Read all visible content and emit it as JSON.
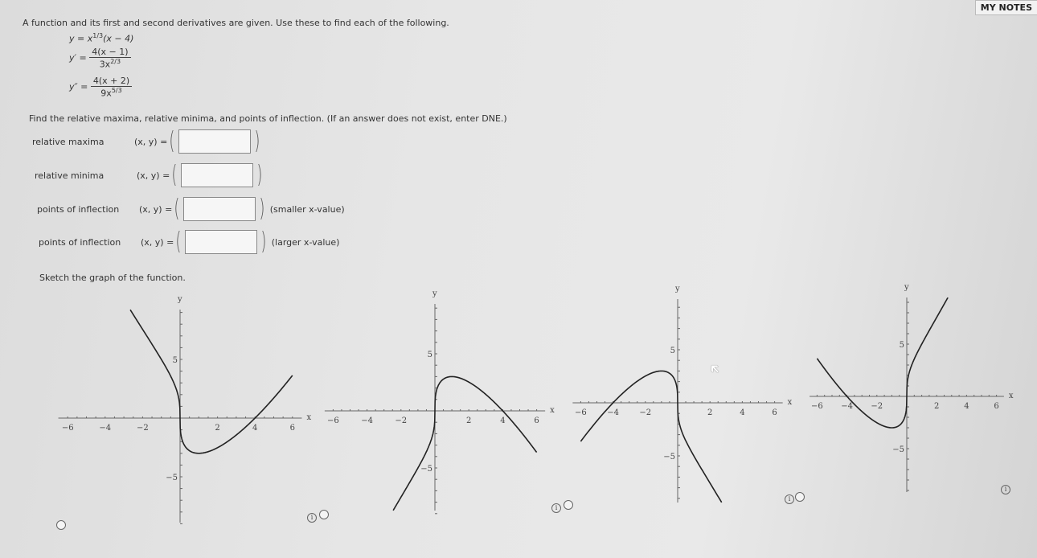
{
  "header": {
    "my_notes_label": "MY NOTES"
  },
  "intro": "A function and its first and second derivatives are given. Use these to find each of the following.",
  "equations": {
    "y": {
      "lhs": "y =",
      "base": "x",
      "exp": "1/3",
      "rest": "(x − 4)"
    },
    "y1": {
      "lhs": "y′ =",
      "num": "4(x − 1)",
      "den_base": "3x",
      "den_exp": "2/3"
    },
    "y2": {
      "lhs": "y″ =",
      "num": "4(x + 2)",
      "den_base": "9x",
      "den_exp": "5/3"
    }
  },
  "instruction": "Find the relative maxima, relative minima, and points of inflection. (If an answer does not exist, enter DNE.)",
  "answers": [
    {
      "label": "relative maxima",
      "xy": "(x, y) =",
      "value": "",
      "note": ""
    },
    {
      "label": "relative minima",
      "xy": "(x, y) =",
      "value": "",
      "note": ""
    },
    {
      "label": "points of inflection",
      "xy": "(x, y) =",
      "value": "",
      "note": "(smaller x-value)"
    },
    {
      "label": "points of inflection",
      "xy": "(x, y) =",
      "value": "",
      "note": "(larger x-value)"
    }
  ],
  "sketch_prompt": "Sketch the graph of the function.",
  "graphs": [
    {
      "reflect_x": false,
      "negate": false,
      "selected": false
    },
    {
      "reflect_x": false,
      "negate": true,
      "selected": false
    },
    {
      "reflect_x": true,
      "negate": true,
      "selected": false
    },
    {
      "reflect_x": true,
      "negate": false,
      "selected": false
    }
  ],
  "axes": {
    "x_label": "x",
    "y_label": "y",
    "x_ticks": [
      "−6",
      "−4",
      "−2",
      "2",
      "4",
      "6"
    ],
    "y_ticks": [
      "5",
      "−5"
    ]
  },
  "info_symbol": "i"
}
